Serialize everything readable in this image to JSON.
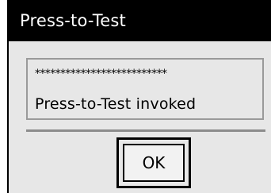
{
  "dialog": {
    "title": "Press-to-Test",
    "message_mask": "**************************",
    "message": "Press-to-Test invoked",
    "ok_label": "OK"
  },
  "colors": {
    "titlebar": "#000000",
    "title_text": "#ffffff",
    "dialog_bg": "#e7e7e7",
    "border_gray": "#9a9a9a",
    "divider_gray": "#8c8c8c"
  }
}
